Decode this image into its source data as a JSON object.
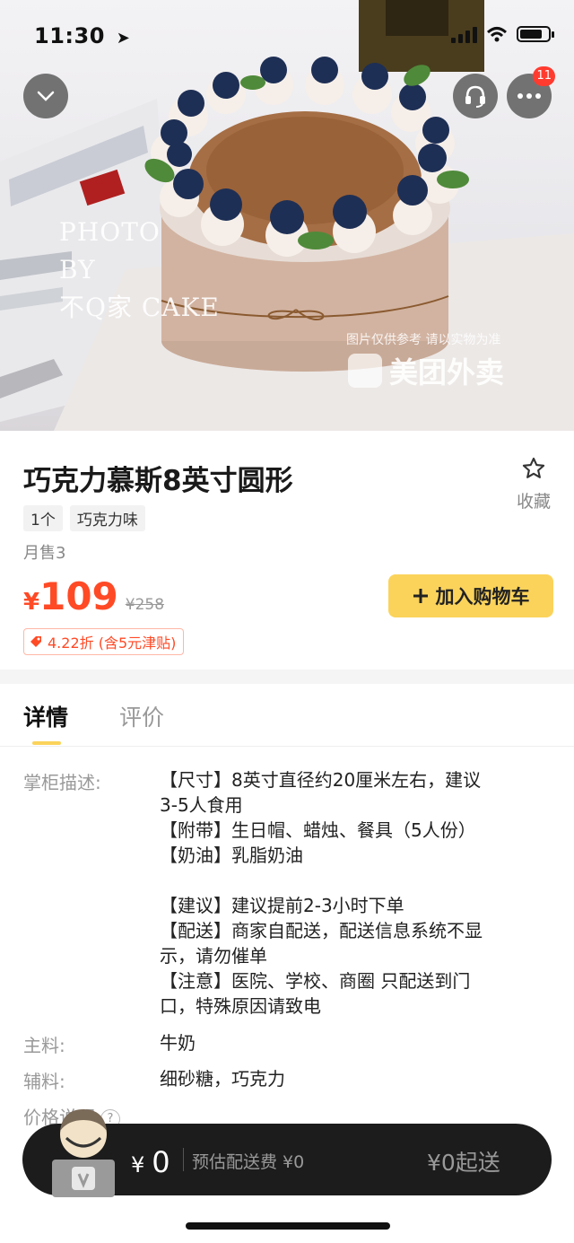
{
  "status_bar": {
    "time": "11:30"
  },
  "hero": {
    "more_badge": "11",
    "watermark_lines": [
      "PHOTO",
      "BY",
      "不Q家  CAKE"
    ],
    "watermark_note": "图片仅供参考 请以实物为准",
    "watermark_brand": "美团外卖"
  },
  "product": {
    "title": "巧克力慕斯8英寸圆形",
    "favorite_label": "收藏",
    "tags": [
      "1个",
      "巧克力味"
    ],
    "monthly_sales": "月售3",
    "price_currency": "¥",
    "price": "109",
    "original_price": "¥258",
    "add_to_cart_label": "加入购物车",
    "discount": "4.22折 (含5元津贴)"
  },
  "tabs": [
    {
      "label": "详情",
      "active": true
    },
    {
      "label": "评价",
      "active": false
    }
  ],
  "details": {
    "description_label": "掌柜描述:",
    "description_lines": [
      "【尺寸】8英寸直径约20厘米左右，建议",
      "3-5人食用",
      "【附带】生日帽、蜡烛、餐具（5人份）",
      "【奶油】乳脂奶油",
      "",
      "【建议】建议提前2-3小时下单",
      "【配送】商家自配送，配送信息系统不显",
      "示，请勿催单",
      "【注意】医院、学校、商圈 只配送到门",
      "口，特殊原因请致电"
    ],
    "main_ingredient_label": "主料:",
    "main_ingredient": "牛奶",
    "aux_ingredient_label": "辅料:",
    "aux_ingredient": "细砂糖，巧克力",
    "price_note_label": "价格说明",
    "price_note_icon": "?"
  },
  "cart_bar": {
    "currency": "¥",
    "total": "0",
    "delivery_fee": "预估配送费 ¥0",
    "min_order": "¥0起送"
  },
  "colors": {
    "accent_price": "#ff4a26",
    "cart_button": "#fbd35b",
    "cart_bar": "#1c1c1c",
    "badge": "#ff3b30"
  }
}
